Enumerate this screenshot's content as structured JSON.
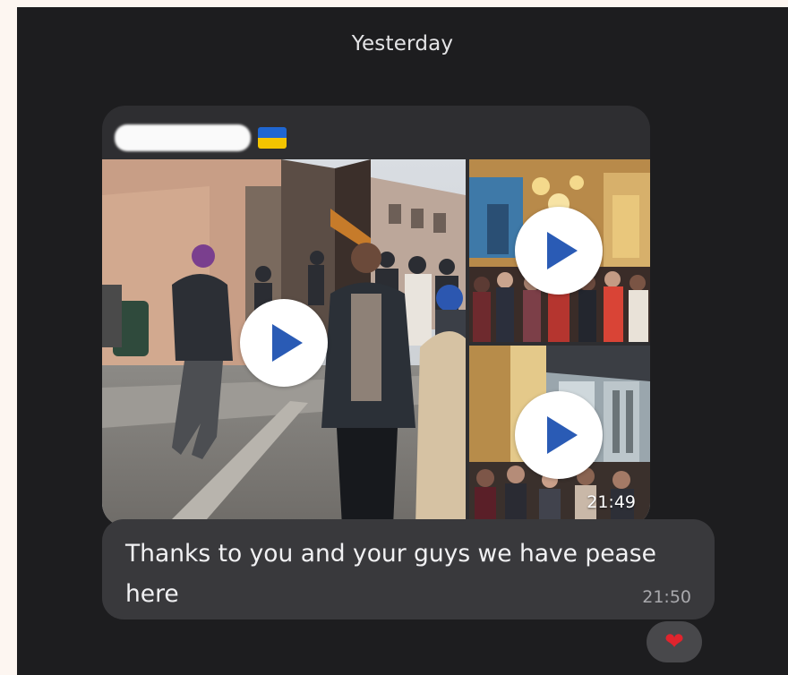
{
  "chat": {
    "date_separator": "Yesterday",
    "media_message": {
      "sender_flag": "ukraine-flag",
      "videos": [
        {
          "icon": "play-icon"
        },
        {
          "icon": "play-icon"
        },
        {
          "icon": "play-icon"
        }
      ],
      "time": "21:49"
    },
    "text_message": {
      "text": "Thanks to you and your guys we have pease here",
      "time": "21:50"
    },
    "reaction": {
      "emoji": "❤",
      "icon": "heart-icon"
    }
  },
  "colors": {
    "background": "#1d1d1f",
    "bubble": "#39393c",
    "play_triangle": "#2a5bb5",
    "heart": "#e0242d"
  }
}
